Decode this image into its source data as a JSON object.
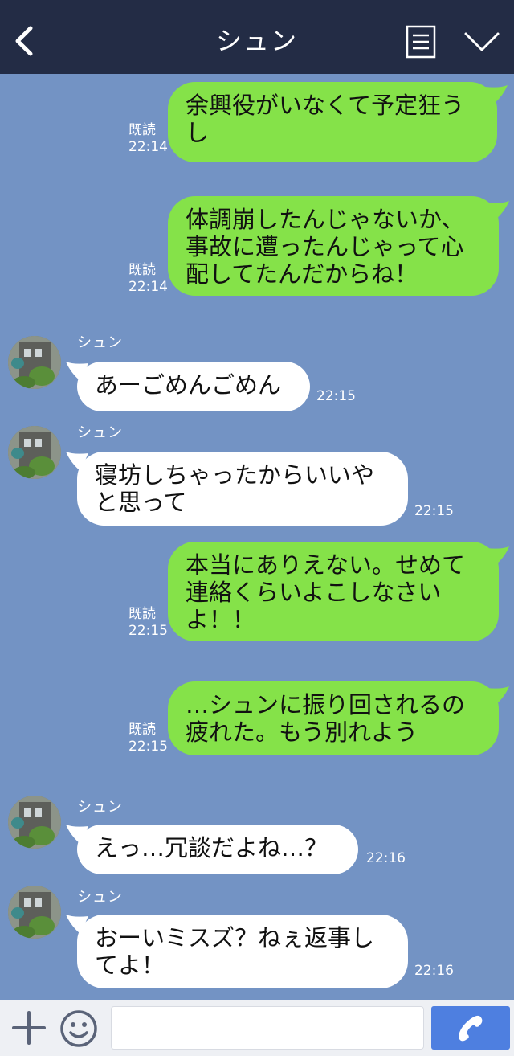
{
  "header": {
    "title": "シュン",
    "icons": [
      "chevron-left-icon",
      "menu-list-icon",
      "chevron-down-icon"
    ]
  },
  "messages": [
    {
      "from": "me",
      "text": "余興役がいなくて予定狂うし",
      "read": "既読",
      "time": "22:14"
    },
    {
      "from": "me",
      "text": "体調崩したんじゃないか、事故に遭ったんじゃって心配してたんだからね！",
      "read": "既読",
      "time": "22:14"
    },
    {
      "from": "them",
      "sender": "シュン",
      "text": "あーごめんごめん",
      "time": "22:15"
    },
    {
      "from": "them",
      "sender": "シュン",
      "text": "寝坊しちゃったからいいやと思って",
      "time": "22:15"
    },
    {
      "from": "me",
      "text": "本当にありえない。せめて連絡くらいよこしなさいよ！！",
      "read": "既読",
      "time": "22:15"
    },
    {
      "from": "me",
      "text": "…シュンに振り回されるの疲れた。もう別れよう",
      "read": "既読",
      "time": "22:15"
    },
    {
      "from": "them",
      "sender": "シュン",
      "text": "えっ…冗談だよね…？",
      "time": "22:16"
    },
    {
      "from": "them",
      "sender": "シュン",
      "text": "おーいミスズ？ねぇ返事してよ！",
      "time": "22:16"
    }
  ],
  "footer": {
    "input_placeholder": "",
    "icons": [
      "plus-icon",
      "smiley-icon",
      "phone-icon"
    ]
  },
  "colors": {
    "header_bg": "#232c45",
    "chat_bg": "#7393c4",
    "my_bubble": "#85e249",
    "their_bubble": "#ffffff",
    "call_button": "#4e7fe0"
  }
}
